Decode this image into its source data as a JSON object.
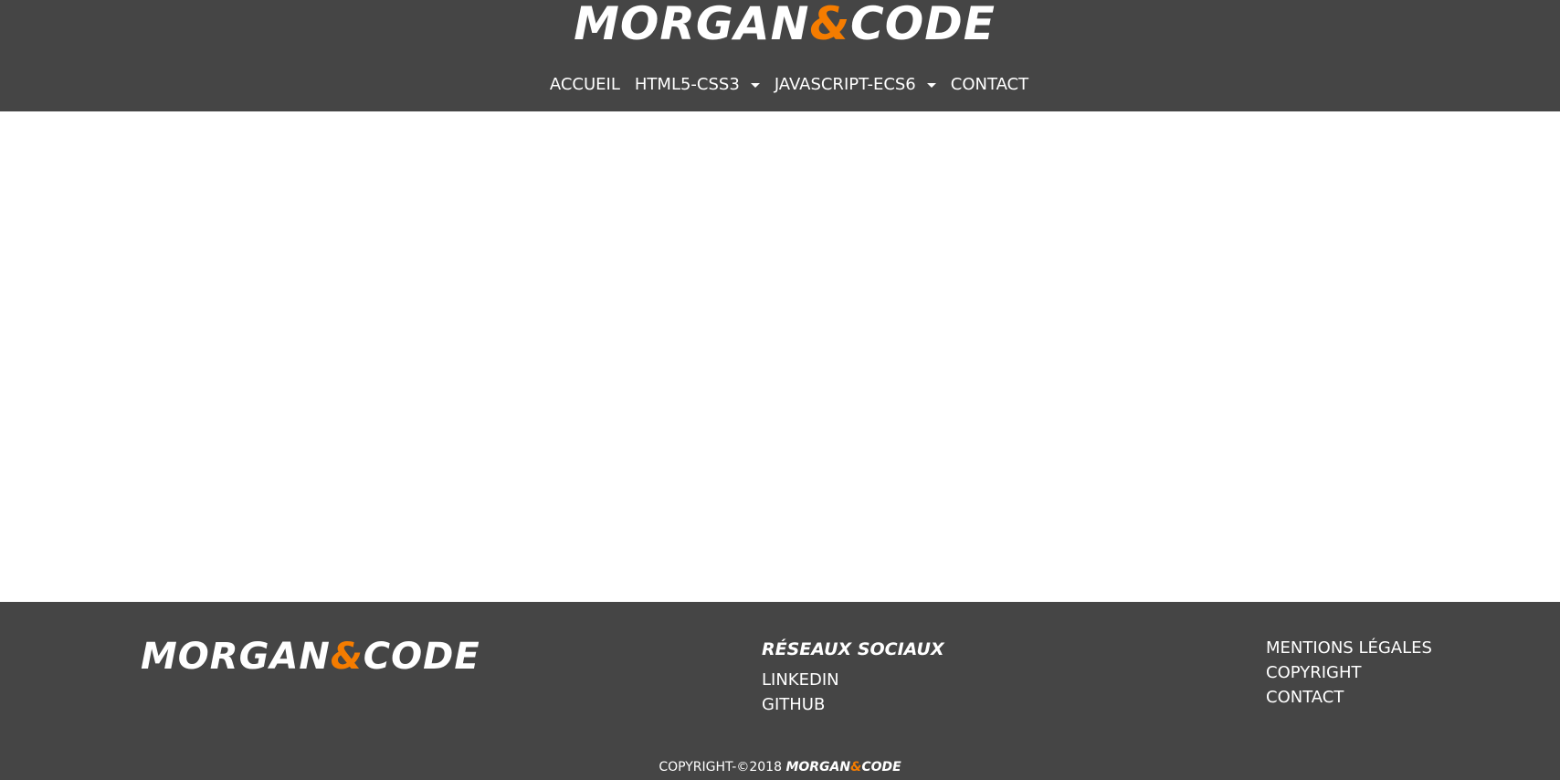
{
  "brand": {
    "part1": "MORGAN",
    "amp": "&",
    "part2": "CODE"
  },
  "nav": {
    "items": [
      {
        "label": "ACCUEIL",
        "dropdown": false
      },
      {
        "label": "HTML5-CSS3",
        "dropdown": true
      },
      {
        "label": "JAVASCRIPT-ECS6",
        "dropdown": true
      },
      {
        "label": "CONTACT",
        "dropdown": false
      }
    ]
  },
  "footer": {
    "social_title": "RÉSEAUX SOCIAUX",
    "social_links": [
      "LINKEDIN",
      "GITHUB"
    ],
    "legal_links": [
      "MENTIONS LÉGALES",
      "COPYRIGHT",
      "CONTACT"
    ],
    "copyright_text": "COPYRIGHT-©2018"
  },
  "colors": {
    "bar": "#454545",
    "accent": "#f57c00",
    "text": "#ffffff"
  }
}
